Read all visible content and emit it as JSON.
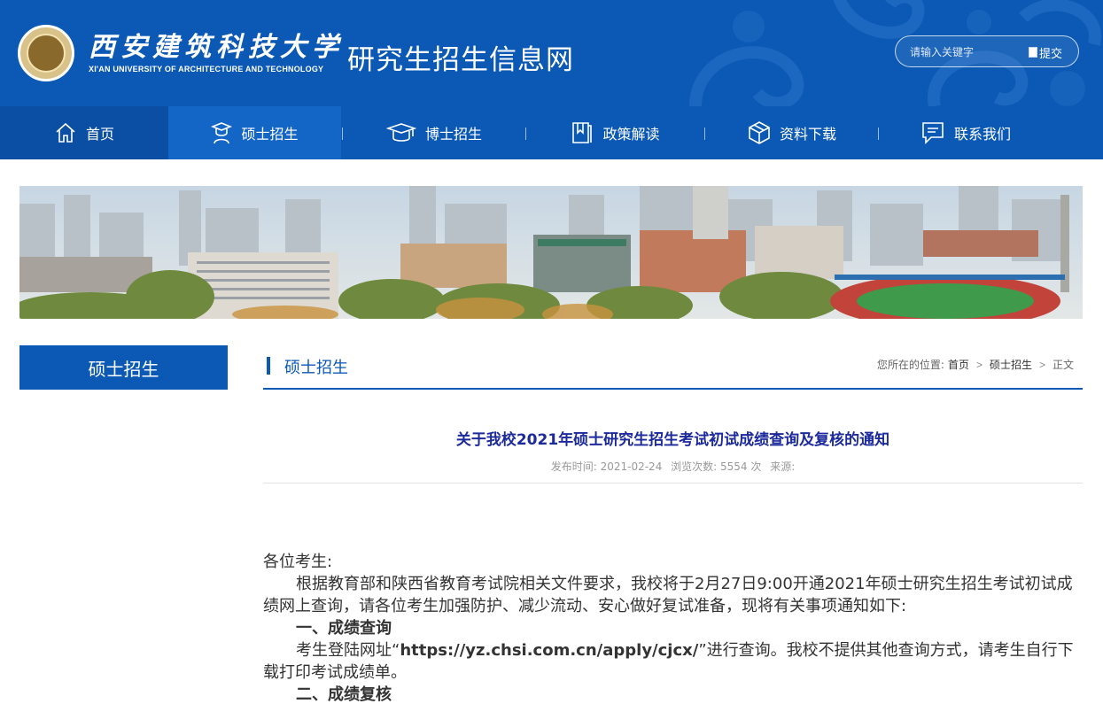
{
  "header": {
    "university_cn": "西安建筑科技大学",
    "university_en": "XI'AN UNIVERSITY OF ARCHITECTURE AND TECHNOLOGY",
    "site_title": "研究生招生信息网",
    "search": {
      "placeholder": "请输入关键字",
      "button_label": "提交"
    }
  },
  "nav": {
    "items": [
      {
        "label": "首页",
        "icon": "home-icon"
      },
      {
        "label": "硕士招生",
        "icon": "graduate-icon"
      },
      {
        "label": "博士招生",
        "icon": "mortarboard-icon"
      },
      {
        "label": "政策解读",
        "icon": "book-icon"
      },
      {
        "label": "资料下载",
        "icon": "box-icon"
      },
      {
        "label": "联系我们",
        "icon": "message-icon"
      }
    ]
  },
  "sidebar": {
    "title": "硕士招生"
  },
  "section": {
    "title": "硕士招生",
    "breadcrumb": {
      "prefix": "您所在的位置:",
      "home": "首页",
      "category": "硕士招生",
      "current": "正文",
      "separator": ">"
    }
  },
  "article": {
    "title": "关于我校2021年硕士研究生招生考试初试成绩查询及复核的通知",
    "meta": {
      "publish_label": "发布时间: 2021-02-24",
      "views_label": "浏览次数: 5554 次",
      "source_label": "来源:"
    },
    "greeting": "各位考生:",
    "para1": "根据教育部和陕西省教育考试院相关文件要求，我校将于2月27日9:00开通2021年硕士研究生招生考试初试成绩网上查询，请各位考生加强防护、减少流动、安心做好复试准备，现将有关事项通知如下:",
    "section1_heading": "一、成绩查询",
    "para2_before": "考生登陆网址“",
    "para2_url": "https://yz.chsi.com.cn/apply/cjcx/",
    "para2_after": "”进行查询。我校不提供其他查询方式，请考生自行下载打印考试成绩单。",
    "section2_heading": "二、成绩复核"
  },
  "colors": {
    "primary": "#0b59b5",
    "title_blue": "#1c2a9c"
  }
}
